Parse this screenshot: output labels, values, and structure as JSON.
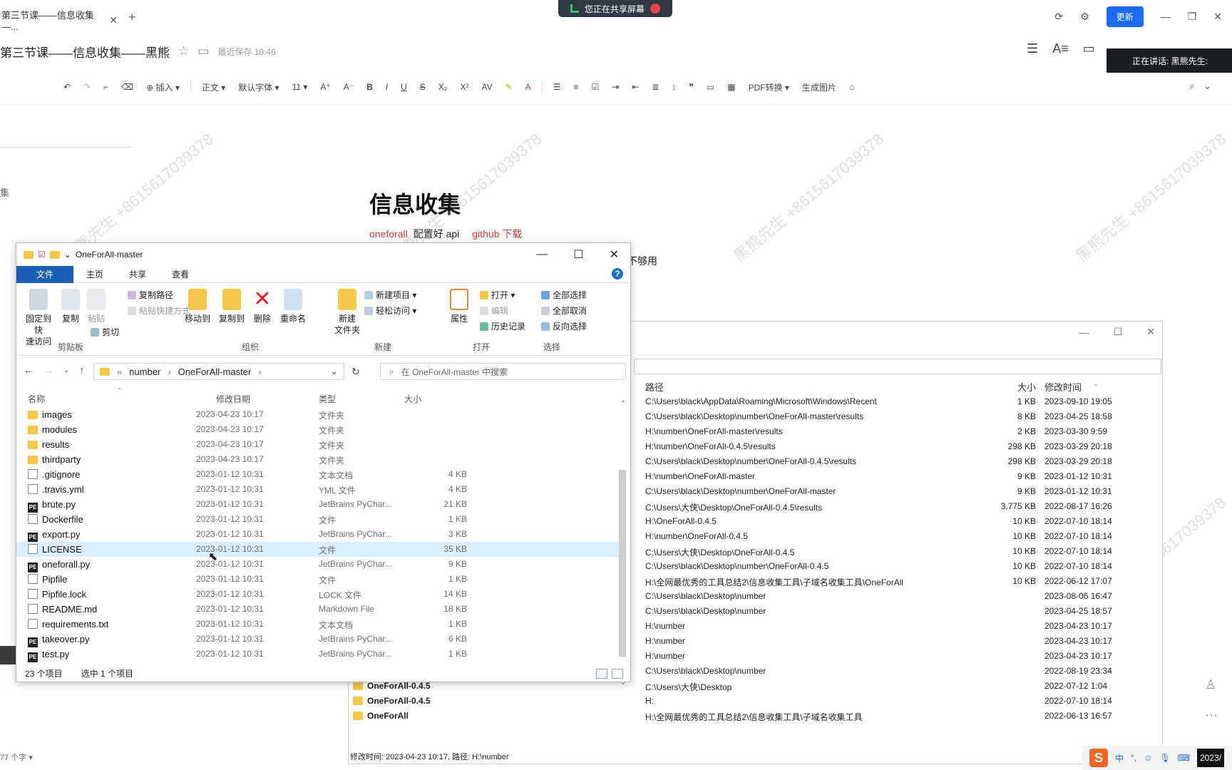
{
  "browser": {
    "tab_title": "第三节课——信息收集—...",
    "tab_close": "✕",
    "new_tab": "+",
    "share_text": "您正在共享屏幕",
    "update_label": "更新"
  },
  "doc": {
    "title": "第三节课——信息收集——黑熊",
    "save_status": "最近保存 18:46",
    "speaking": "正在讲话: 黑熊先生:",
    "left_item": "集",
    "heading": "信息收集",
    "line1_link1": "oneforall",
    "line1_text": "配置好 api",
    "line1_link2": "github 下载",
    "line2_tail": "不够用",
    "word_count": "77 个字 ▾",
    "watermark": "黑熊先生 +8615617039378"
  },
  "toolbar": {
    "insert": "⊕ 插入 ▾",
    "style": "正文 ▾",
    "font": "默认字体 ▾",
    "size": "11 ▾",
    "bold": "B",
    "italic": "I",
    "underline": "U",
    "strike": "S",
    "pdf": "PDF转换 ▾",
    "genimg": "生成图片"
  },
  "explorer": {
    "title": "OneForAll-master",
    "tabs": [
      "文件",
      "主页",
      "共享",
      "查看"
    ],
    "ribbon": {
      "pin": "固定到快\n速访问",
      "copy": "复制",
      "paste": "粘贴",
      "copy_path": "复制路径",
      "paste_shortcut": "粘贴快捷方式",
      "cut": "剪切",
      "clipboard": "剪贴板",
      "move_to": "移动到",
      "copy_to": "复制到",
      "delete": "删除",
      "rename": "重命名",
      "organize": "组织",
      "new_folder": "新建\n文件夹",
      "new_item": "新建项目 ▾",
      "easy_access": "轻松访问 ▾",
      "new": "新建",
      "properties": "属性",
      "open": "打开 ▾",
      "edit": "编辑",
      "history": "历史记录",
      "open_group": "打开",
      "select_all": "全部选择",
      "select_none": "全部取消",
      "invert": "反向选择",
      "select_group": "选择"
    },
    "breadcrumb": [
      "«",
      "number",
      "OneForAll-master"
    ],
    "search_placeholder": "在 OneForAll-master 中搜索",
    "columns": {
      "name": "名称",
      "date": "修改日期",
      "type": "类型",
      "size": "大小"
    },
    "files": [
      {
        "name": "images",
        "date": "2023-04-23 10:17",
        "type": "文件夹",
        "size": "",
        "icon": "folder"
      },
      {
        "name": "modules",
        "date": "2023-04-23 10:17",
        "type": "文件夹",
        "size": "",
        "icon": "folder"
      },
      {
        "name": "results",
        "date": "2023-04-23 10:17",
        "type": "文件夹",
        "size": "",
        "icon": "folder"
      },
      {
        "name": "thirdparty",
        "date": "2023-04-23 10:17",
        "type": "文件夹",
        "size": "",
        "icon": "folder"
      },
      {
        "name": ".gitignore",
        "date": "2023-01-12 10:31",
        "type": "文本文档",
        "size": "4 KB",
        "icon": "doc"
      },
      {
        "name": ".travis.yml",
        "date": "2023-01-12 10:31",
        "type": "YML 文件",
        "size": "4 KB",
        "icon": "doc"
      },
      {
        "name": "brute.py",
        "date": "2023-01-12 10:31",
        "type": "JetBrains PyChar...",
        "size": "21 KB",
        "icon": "pe"
      },
      {
        "name": "Dockerfile",
        "date": "2023-01-12 10:31",
        "type": "文件",
        "size": "1 KB",
        "icon": "doc"
      },
      {
        "name": "export.py",
        "date": "2023-01-12 10:31",
        "type": "JetBrains PyChar...",
        "size": "3 KB",
        "icon": "pe"
      },
      {
        "name": "LICENSE",
        "date": "2023-01-12 10:31",
        "type": "文件",
        "size": "35 KB",
        "icon": "doc"
      },
      {
        "name": "oneforall.py",
        "date": "2023-01-12 10:31",
        "type": "JetBrains PyChar...",
        "size": "9 KB",
        "icon": "pe"
      },
      {
        "name": "Pipfile",
        "date": "2023-01-12 10:31",
        "type": "文件",
        "size": "1 KB",
        "icon": "doc"
      },
      {
        "name": "Pipfile.lock",
        "date": "2023-01-12 10:31",
        "type": "LOCK 文件",
        "size": "14 KB",
        "icon": "doc"
      },
      {
        "name": "README.md",
        "date": "2023-01-12 10:31",
        "type": "Markdown File",
        "size": "18 KB",
        "icon": "doc"
      },
      {
        "name": "requirements.txt",
        "date": "2023-01-12 10:31",
        "type": "文本文档",
        "size": "1 KB",
        "icon": "doc"
      },
      {
        "name": "takeover.py",
        "date": "2023-01-12 10:31",
        "type": "JetBrains PyChar...",
        "size": "6 KB",
        "icon": "pe"
      },
      {
        "name": "test.py",
        "date": "2023-01-12 10:31",
        "type": "JetBrains PyChar...",
        "size": "1 KB",
        "icon": "pe"
      }
    ],
    "item_count": "23 个项目",
    "selected_count": "选中 1 个项目"
  },
  "search_window": {
    "columns": {
      "path": "路径",
      "size": "大小",
      "date": "修改时间"
    },
    "rows": [
      {
        "name": "",
        "path": "C:\\Users\\black\\AppData\\Roaming\\Microsoft\\Windows\\Recent",
        "size": "1 KB",
        "date": "2023-09-10 19:05"
      },
      {
        "name": "",
        "path": "C:\\Users\\black\\Desktop\\number\\OneForAll-master\\results",
        "size": "8 KB",
        "date": "2023-04-25 18:58"
      },
      {
        "name": "",
        "path": "H:\\number\\OneForAll-master\\results",
        "size": "2 KB",
        "date": "2023-03-30 9:59"
      },
      {
        "name": "",
        "path": "H:\\number\\OneForAll-0.4.5\\results",
        "size": "298 KB",
        "date": "2023-03-29 20:18"
      },
      {
        "name": "",
        "path": "C:\\Users\\black\\Desktop\\number\\OneForAll-0.4.5\\results",
        "size": "298 KB",
        "date": "2023-03-29 20:18"
      },
      {
        "name": "",
        "path": "H:\\number\\OneForAll-master",
        "size": "9 KB",
        "date": "2023-01-12 10:31"
      },
      {
        "name": "",
        "path": "C:\\Users\\black\\Desktop\\number\\OneForAll-master",
        "size": "9 KB",
        "date": "2023-01-12 10:31"
      },
      {
        "name": "",
        "path": "C:\\Users\\大侠\\Desktop\\OneForAll-0.4.5\\results",
        "size": "3,775 KB",
        "date": "2022-08-17 16:26"
      },
      {
        "name": "",
        "path": "H:\\OneForAll-0.4.5",
        "size": "10 KB",
        "date": "2022-07-10 18:14"
      },
      {
        "name": "",
        "path": "H:\\number\\OneForAll-0.4.5",
        "size": "10 KB",
        "date": "2022-07-10 18:14"
      },
      {
        "name": "",
        "path": "C:\\Users\\大侠\\Desktop\\OneForAll-0.4.5",
        "size": "10 KB",
        "date": "2022-07-10 18:14"
      },
      {
        "name": "",
        "path": "C:\\Users\\black\\Desktop\\number\\OneForAll-0.4.5",
        "size": "10 KB",
        "date": "2022-07-10 18:14"
      },
      {
        "name": "",
        "path": "H:\\全网最优秀的工具总结2\\信息收集工具\\子域名收集工具\\OneForAll",
        "size": "10 KB",
        "date": "2022-06-12 17:07"
      },
      {
        "name": "",
        "path": "C:\\Users\\black\\Desktop\\number",
        "size": "",
        "date": "2023-08-06 16:47"
      },
      {
        "name": "",
        "path": "C:\\Users\\black\\Desktop\\number",
        "size": "",
        "date": "2023-04-25 18:57"
      },
      {
        "name": "",
        "path": "H:\\number",
        "size": "",
        "date": "2023-04-23 10:17"
      },
      {
        "name": "",
        "path": "H:\\number",
        "size": "",
        "date": "2023-04-23 10:17"
      },
      {
        "name": "",
        "path": "H:\\number",
        "size": "",
        "date": "2023-04-23 10:17"
      },
      {
        "name": "",
        "path": "C:\\Users\\black\\Desktop\\number",
        "size": "",
        "date": "2022-08-19 23:34"
      },
      {
        "name": "OneForAll-0.4.5",
        "path": "C:\\Users\\大侠\\Desktop",
        "size": "",
        "date": "2022-07-12 1:04"
      },
      {
        "name": "OneForAll-0.4.5",
        "path": "H:",
        "size": "",
        "date": "2022-07-10 18:14"
      },
      {
        "name": "OneForAll",
        "path": "H:\\全网最优秀的工具总结2\\信息收集工具\\子域名收集工具",
        "size": "",
        "date": "2022-06-13 16:57"
      }
    ],
    "status": "修改时间: 2023-04-23 10:17, 路径: H:\\number"
  },
  "taskbar": {
    "ime": "中",
    "clock": "2023/"
  },
  "colors": {
    "accent": "#1a6df0",
    "explorer_file_tab": "#1a5fb4",
    "link_red": "#c63b3b",
    "folder": "#f6c84a"
  }
}
